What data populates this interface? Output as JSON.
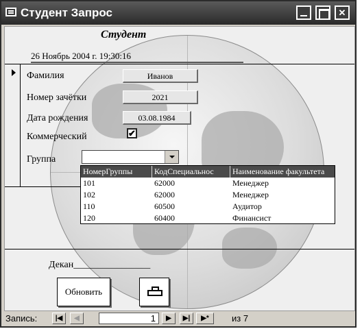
{
  "window": {
    "title": "Студент Запрос"
  },
  "form": {
    "title": "Студент",
    "datetime": "26 Ноябрь 2004 г. 19:30:16",
    "fields": {
      "surname": {
        "label": "Фамилия",
        "value": "Иванов"
      },
      "record_book": {
        "label": "Номер зачётки",
        "value": "2021"
      },
      "birth_date": {
        "label": "Дата рождения",
        "value": "03.08.1984"
      },
      "commercial": {
        "label": "Коммерческий",
        "checked": true,
        "mark": "✔"
      },
      "group": {
        "label": "Группа",
        "value": ""
      }
    },
    "dropdown": {
      "columns": [
        "НомерГруппы",
        "КодСпециальнос",
        "Наименование факультета"
      ],
      "rows": [
        [
          "101",
          "62000",
          "Менеджер"
        ],
        [
          "102",
          "62000",
          "Менеджер"
        ],
        [
          "110",
          "60500",
          "Аудитор"
        ],
        [
          "120",
          "60400",
          "Финансист"
        ]
      ]
    },
    "footer": {
      "dean_label": "Декан________________",
      "refresh_button": "Обновить",
      "print_icon": "printer-icon"
    }
  },
  "navigation": {
    "record_label": "Запись:",
    "current": "1",
    "total_label": "из  7",
    "first": "|◀",
    "prev": "◀",
    "next": "▶",
    "last": "▶|",
    "new": "▶*"
  }
}
